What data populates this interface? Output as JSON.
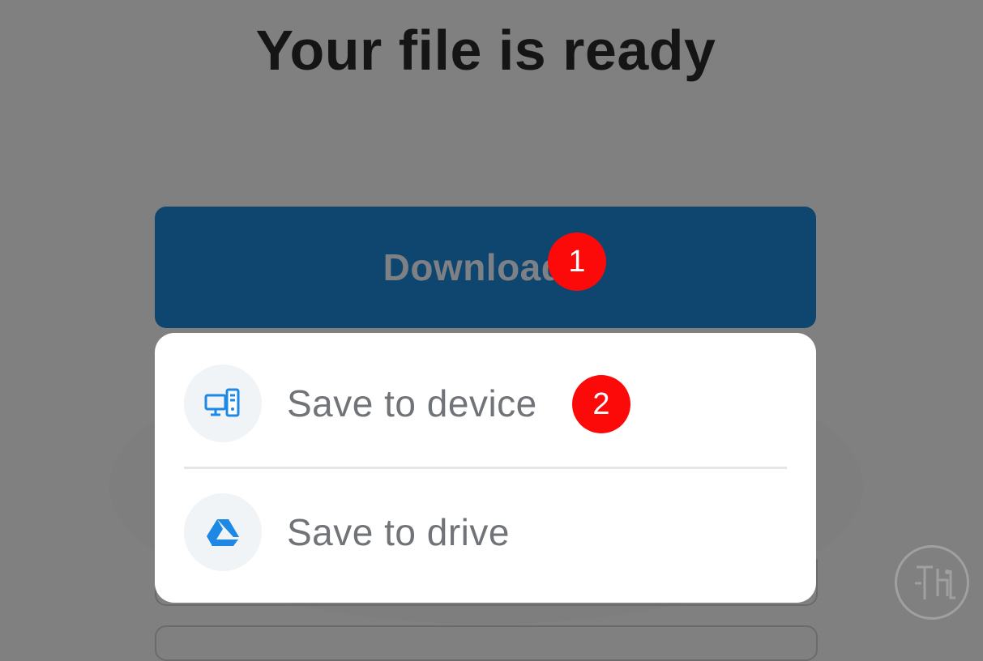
{
  "page": {
    "title": "Your file is ready"
  },
  "download_button": {
    "label": "Download",
    "icon": "chevron-down-icon"
  },
  "dropdown": {
    "items": [
      {
        "label": "Save to device",
        "icon": "computer-icon"
      },
      {
        "label": "Save to drive",
        "icon": "google-drive-icon"
      }
    ]
  },
  "annotations": {
    "step_1": "1",
    "step_2": "2"
  },
  "colors": {
    "overlay": "#808080",
    "button_bg": "#0f4670",
    "badge": "#fc0a0a",
    "icon_blue": "#1e88e5"
  },
  "watermark": {
    "icon": "logo-watermark-icon"
  }
}
